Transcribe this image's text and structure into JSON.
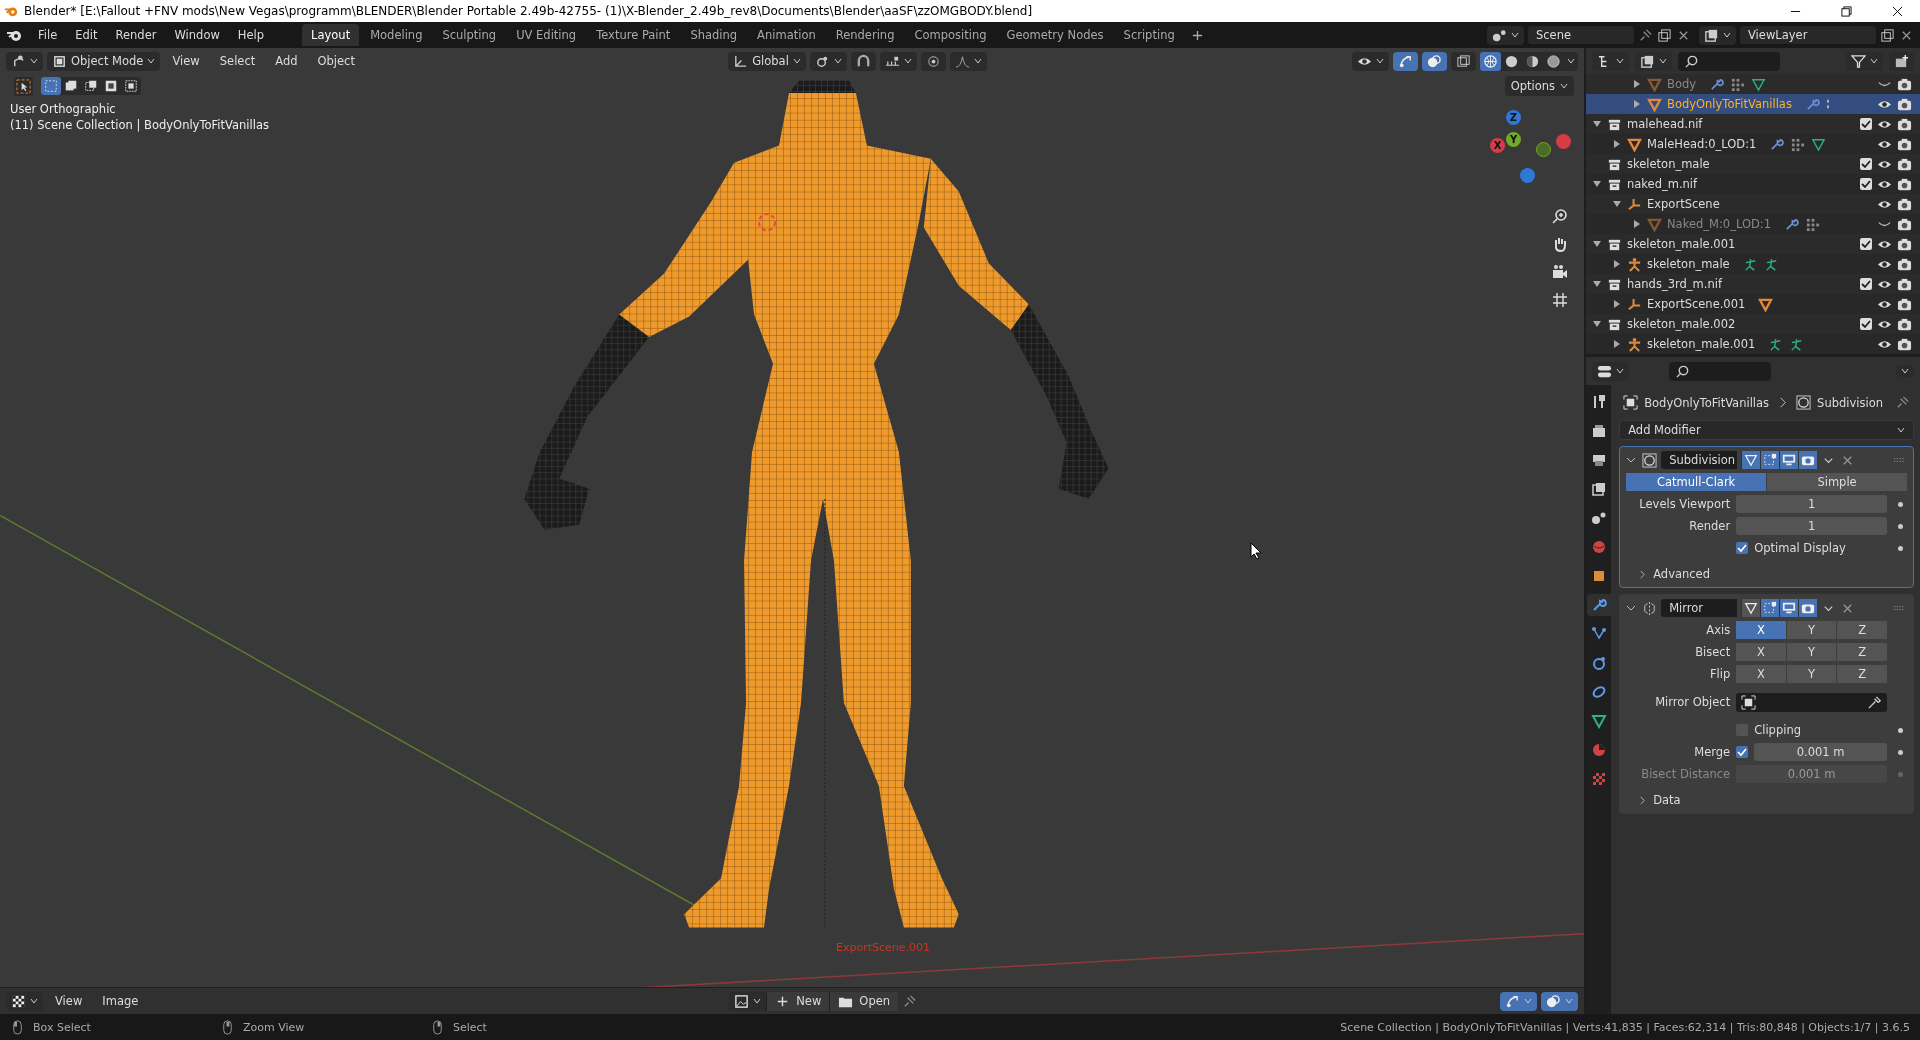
{
  "window": {
    "title": "Blender* [E:\\Fallout +FNV mods\\New Vegas\\programm\\BLENDER\\Blender Portable 2.49b-42755- (1)\\X-Blender_2.49b_rev8\\Documents\\Blender\\aaSF\\zzOMGBODY.blend]"
  },
  "menu": [
    "File",
    "Edit",
    "Render",
    "Window",
    "Help"
  ],
  "workspaces": [
    {
      "label": "Layout",
      "selected": true
    },
    {
      "label": "Modeling",
      "selected": false
    },
    {
      "label": "Sculpting",
      "selected": false
    },
    {
      "label": "UV Editing",
      "selected": false
    },
    {
      "label": "Texture Paint",
      "selected": false
    },
    {
      "label": "Shading",
      "selected": false
    },
    {
      "label": "Animation",
      "selected": false
    },
    {
      "label": "Rendering",
      "selected": false
    },
    {
      "label": "Compositing",
      "selected": false
    },
    {
      "label": "Geometry Nodes",
      "selected": false
    },
    {
      "label": "Scripting",
      "selected": false
    }
  ],
  "scene": "Scene",
  "view_layer": "ViewLayer",
  "viewport": {
    "mode": "Object Mode",
    "menus": [
      "View",
      "Select",
      "Add",
      "Object"
    ],
    "orientation": "Global",
    "options": "Options",
    "snap": {
      "on": false
    },
    "proportional_editing": {
      "on": false
    },
    "select_modes": [
      {
        "selected": true
      },
      {
        "selected": false
      },
      {
        "selected": false
      },
      {
        "selected": false
      },
      {
        "selected": false
      }
    ],
    "toggles": [
      {
        "kind": "gizmo",
        "on": true
      },
      {
        "kind": "overlay",
        "on": true
      },
      {
        "kind": "xray",
        "on": false
      }
    ],
    "shading": [
      {
        "kind": "wireframe",
        "selected": true
      },
      {
        "kind": "solid",
        "selected": false
      },
      {
        "kind": "material",
        "selected": false
      },
      {
        "kind": "rendered",
        "selected": false
      }
    ],
    "info": [
      "User Orthographic",
      "(11) Scene Collection | BodyOnlyToFitVanillas"
    ],
    "object_label": "ExportScene.001",
    "gizmo": [
      {
        "label": "Z",
        "color": "#2f79d6"
      },
      {
        "label": "Y",
        "color": "#71a92a"
      },
      {
        "label": "X",
        "color": "#d63b48"
      }
    ]
  },
  "outliner": {
    "scrolled_rows": [
      {
        "name": "Body",
        "kind": "mesh",
        "expanded": false,
        "selected": false,
        "dimmed": true,
        "hidden": true,
        "badges": [
          {
            "kind": "wrench"
          },
          {
            "kind": "vertex-groups"
          },
          {
            "kind": "mesh-data"
          }
        ]
      },
      {
        "name": "BodyOnlyToFitVanillas",
        "kind": "mesh",
        "expanded": false,
        "selected": true,
        "dimmed": false,
        "hidden": false,
        "badges": [
          {
            "kind": "wrench"
          },
          {
            "kind": "more"
          }
        ]
      }
    ],
    "collections": [
      {
        "name": "malehead.nif",
        "expandable": true,
        "expanded": true,
        "checked": true,
        "selected": false,
        "children": [
          {
            "name": "MaleHead:0_LOD:1",
            "kind": "mesh",
            "expanded": false,
            "selected": false,
            "dimmed": false,
            "hidden": false,
            "badges": [
              {
                "kind": "wrench"
              },
              {
                "kind": "vertex-groups"
              },
              {
                "kind": "mesh-data"
              }
            ]
          }
        ]
      },
      {
        "name": "skeleton_male",
        "expandable": false,
        "expanded": false,
        "checked": true,
        "selected": false
      },
      {
        "name": "naked_m.nif",
        "expandable": true,
        "expanded": true,
        "checked": true,
        "selected": false,
        "children": [
          {
            "name": "ExportScene",
            "kind": "empty",
            "expanded": true,
            "selected": false,
            "dimmed": false,
            "hidden": false,
            "children": [
              {
                "name": "Naked_M:0_LOD:1",
                "kind": "mesh",
                "expanded": false,
                "selected": false,
                "dimmed": true,
                "hidden": true,
                "badges": [
                  {
                    "kind": "wrench"
                  },
                  {
                    "kind": "vertex-groups"
                  }
                ]
              }
            ]
          }
        ]
      },
      {
        "name": "skeleton_male.001",
        "expandable": true,
        "expanded": true,
        "checked": true,
        "selected": false,
        "children": [
          {
            "name": "skeleton_male",
            "kind": "armature",
            "expanded": false,
            "selected": false,
            "dimmed": false,
            "hidden": false,
            "badges": [
              {
                "kind": "pose"
              },
              {
                "kind": "pose"
              }
            ]
          }
        ]
      },
      {
        "name": "hands_3rd_m.nif",
        "expandable": true,
        "expanded": true,
        "checked": true,
        "selected": false,
        "children": [
          {
            "name": "ExportScene.001",
            "kind": "empty",
            "expanded": false,
            "selected": false,
            "dimmed": false,
            "hidden": false,
            "badges": [
              {
                "kind": "mesh-object"
              }
            ]
          }
        ]
      },
      {
        "name": "skeleton_male.002",
        "expandable": true,
        "expanded": true,
        "checked": true,
        "selected": false,
        "children": [
          {
            "name": "skeleton_male.001",
            "kind": "armature",
            "expanded": false,
            "selected": false,
            "dimmed": false,
            "hidden": false,
            "badges": [
              {
                "kind": "pose"
              },
              {
                "kind": "pose"
              }
            ]
          }
        ]
      }
    ]
  },
  "properties": {
    "tabs": [
      {
        "kind": "tool",
        "selected": false
      },
      {
        "kind": "render",
        "selected": false
      },
      {
        "kind": "output",
        "selected": false
      },
      {
        "kind": "view-layer",
        "selected": false
      },
      {
        "kind": "scene",
        "selected": false
      },
      {
        "kind": "world",
        "selected": false
      },
      {
        "kind": "object",
        "selected": false
      },
      {
        "kind": "modifier",
        "selected": true
      },
      {
        "kind": "particles",
        "selected": false
      },
      {
        "kind": "physics",
        "selected": false
      },
      {
        "kind": "constraints",
        "selected": false
      },
      {
        "kind": "data",
        "selected": false
      },
      {
        "kind": "material",
        "selected": false
      },
      {
        "kind": "texture",
        "selected": false
      }
    ],
    "breadcrumb": {
      "object": "BodyOnlyToFitVanillas",
      "modifier": "Subdivision"
    },
    "add_modifier": "Add Modifier",
    "modifiers": [
      {
        "name": "Subdivision",
        "kind": "subdivision",
        "expanded": true,
        "active": true,
        "toggles": [
          {
            "kind": "edit-mode",
            "on": true
          },
          {
            "kind": "on-cage",
            "on": true
          },
          {
            "kind": "viewport",
            "on": true
          },
          {
            "kind": "render",
            "on": true
          }
        ],
        "rows": [
          {
            "kind": "options",
            "options": [
              {
                "label": "Catmull-Clark",
                "selected": true
              },
              {
                "label": "Simple",
                "selected": false
              }
            ]
          },
          {
            "kind": "number",
            "label": "Levels Viewport",
            "value": "1",
            "disabled": false
          },
          {
            "kind": "number",
            "label": "Render",
            "value": "1",
            "disabled": false
          },
          {
            "kind": "checkbox",
            "label": "Optimal Display",
            "checked": true
          },
          {
            "kind": "subpanel",
            "label": "Advanced",
            "expanded": false
          }
        ]
      },
      {
        "name": "Mirror",
        "kind": "mirror",
        "expanded": true,
        "active": false,
        "toggles": [
          {
            "kind": "edit-mode",
            "on": false
          },
          {
            "kind": "on-cage",
            "on": true
          },
          {
            "kind": "viewport",
            "on": true
          },
          {
            "kind": "render",
            "on": true
          }
        ],
        "rows": [
          {
            "kind": "options",
            "label": "Axis",
            "options": [
              {
                "label": "X",
                "selected": true
              },
              {
                "label": "Y",
                "selected": false
              },
              {
                "label": "Z",
                "selected": false
              }
            ]
          },
          {
            "kind": "options",
            "label": "Bisect",
            "options": [
              {
                "label": "X",
                "selected": false
              },
              {
                "label": "Y",
                "selected": false
              },
              {
                "label": "Z",
                "selected": false
              }
            ]
          },
          {
            "kind": "options",
            "label": "Flip",
            "options": [
              {
                "label": "X",
                "selected": false
              },
              {
                "label": "Y",
                "selected": false
              },
              {
                "label": "Z",
                "selected": false
              }
            ]
          },
          {
            "kind": "object",
            "label": "Mirror Object"
          },
          {
            "kind": "checkbox",
            "label": "Clipping",
            "checked": false
          },
          {
            "kind": "check-number",
            "label": "Merge",
            "checked": true,
            "value": "0.001 m"
          },
          {
            "kind": "number",
            "label": "Bisect Distance",
            "value": "0.001 m",
            "disabled": true
          },
          {
            "kind": "subpanel",
            "label": "Data",
            "expanded": false
          }
        ]
      }
    ]
  },
  "image_editor": {
    "menus": [
      "View",
      "Image"
    ],
    "new": "New",
    "open": "Open",
    "toggles": [
      {
        "kind": "gizmo",
        "on": true
      },
      {
        "kind": "overlay",
        "on": true
      }
    ]
  },
  "status_bar": {
    "hints": [
      "Box Select",
      "Zoom View",
      "Select"
    ],
    "stats": "Scene Collection | BodyOnlyToFitVanillas | Verts:41,835 | Faces:62,314 | Tris:80,848 | Objects:1/7 | 3.6.5"
  }
}
